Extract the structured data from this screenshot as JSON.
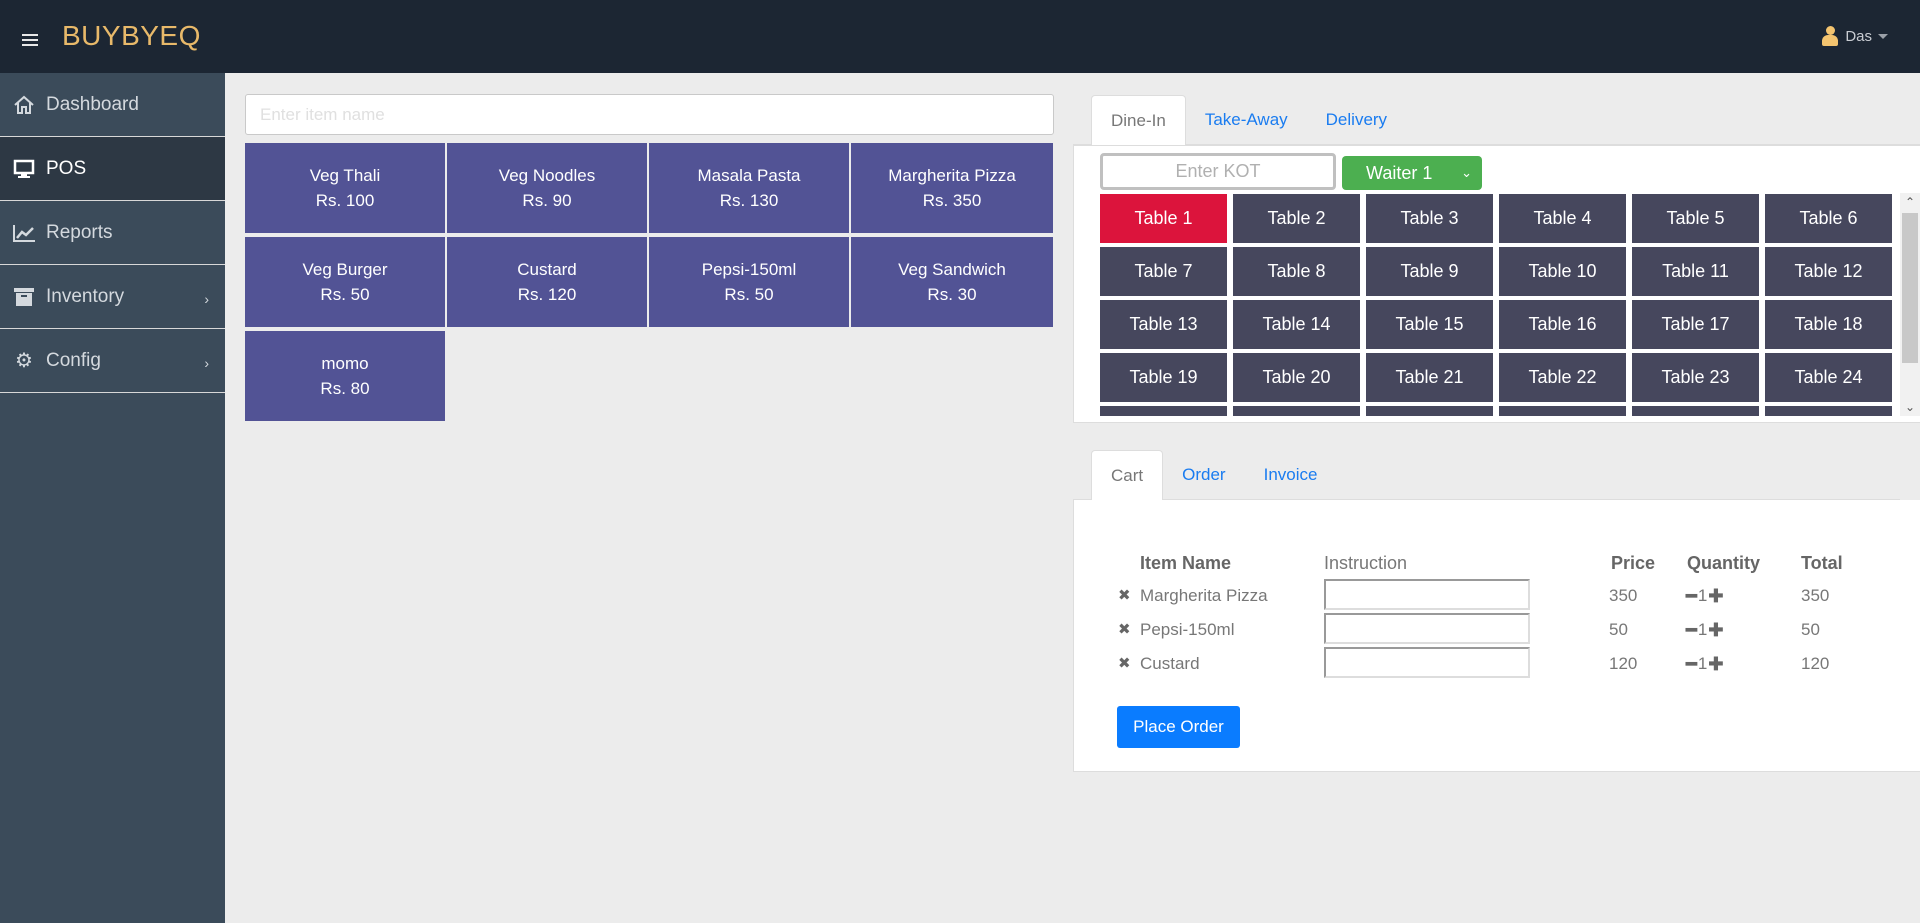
{
  "header": {
    "brand": "BUYBYEQ",
    "user_name": "Das"
  },
  "sidebar": {
    "items": [
      {
        "label": "Dashboard",
        "icon": "home-icon",
        "active": false,
        "submenu": false
      },
      {
        "label": "POS",
        "icon": "monitor-icon",
        "active": true,
        "submenu": false
      },
      {
        "label": "Reports",
        "icon": "chart-line-icon",
        "active": false,
        "submenu": false
      },
      {
        "label": "Inventory",
        "icon": "archive-icon",
        "active": false,
        "submenu": true
      },
      {
        "label": "Config",
        "icon": "gear-icon",
        "active": false,
        "submenu": true
      }
    ]
  },
  "menu": {
    "search_placeholder": "Enter item name",
    "items": [
      {
        "name": "Veg Thali",
        "price": "Rs. 100"
      },
      {
        "name": "Veg Noodles",
        "price": "Rs. 90"
      },
      {
        "name": "Masala Pasta",
        "price": "Rs. 130"
      },
      {
        "name": "Margherita Pizza",
        "price": "Rs. 350"
      },
      {
        "name": "Veg Burger",
        "price": "Rs. 50"
      },
      {
        "name": "Custard",
        "price": "Rs. 120"
      },
      {
        "name": "Pepsi-150ml",
        "price": "Rs. 50"
      },
      {
        "name": "Veg Sandwich",
        "price": "Rs. 30"
      },
      {
        "name": "momo",
        "price": "Rs. 80"
      }
    ]
  },
  "order_type": {
    "tabs": [
      {
        "label": "Dine-In",
        "active": true
      },
      {
        "label": "Take-Away",
        "active": false
      },
      {
        "label": "Delivery",
        "active": false
      }
    ],
    "kot_placeholder": "Enter KOT",
    "waiter_selected": "Waiter 1",
    "selected_table": "Table 1",
    "tables": [
      "Table 1",
      "Table 2",
      "Table 3",
      "Table 4",
      "Table 5",
      "Table 6",
      "Table 7",
      "Table 8",
      "Table 9",
      "Table 10",
      "Table 11",
      "Table 12",
      "Table 13",
      "Table 14",
      "Table 15",
      "Table 16",
      "Table 17",
      "Table 18",
      "Table 19",
      "Table 20",
      "Table 21",
      "Table 22",
      "Table 23",
      "Table 24",
      "",
      "",
      "",
      "",
      "",
      ""
    ]
  },
  "cart": {
    "tabs": [
      {
        "label": "Cart",
        "active": true
      },
      {
        "label": "Order",
        "active": false
      },
      {
        "label": "Invoice",
        "active": false
      }
    ],
    "columns": {
      "item": "Item Name",
      "instruction": "Instruction",
      "price": "Price",
      "quantity": "Quantity",
      "total": "Total"
    },
    "rows": [
      {
        "name": "Margherita Pizza",
        "instruction": "",
        "price": "350",
        "qty": "1",
        "total": "350"
      },
      {
        "name": "Pepsi-150ml",
        "instruction": "",
        "price": "50",
        "qty": "1",
        "total": "50"
      },
      {
        "name": "Custard",
        "instruction": "",
        "price": "120",
        "qty": "1",
        "total": "120"
      }
    ],
    "place_order_label": "Place Order"
  },
  "colors": {
    "topbar": "#1c2633",
    "brand": "#e8b96a",
    "sidebar": "#3b4b5a",
    "menu_tile": "#525395",
    "table_tile": "#46475d",
    "table_selected": "#dc143c",
    "waiter": "#4caf50",
    "primary": "#0a7cff"
  }
}
